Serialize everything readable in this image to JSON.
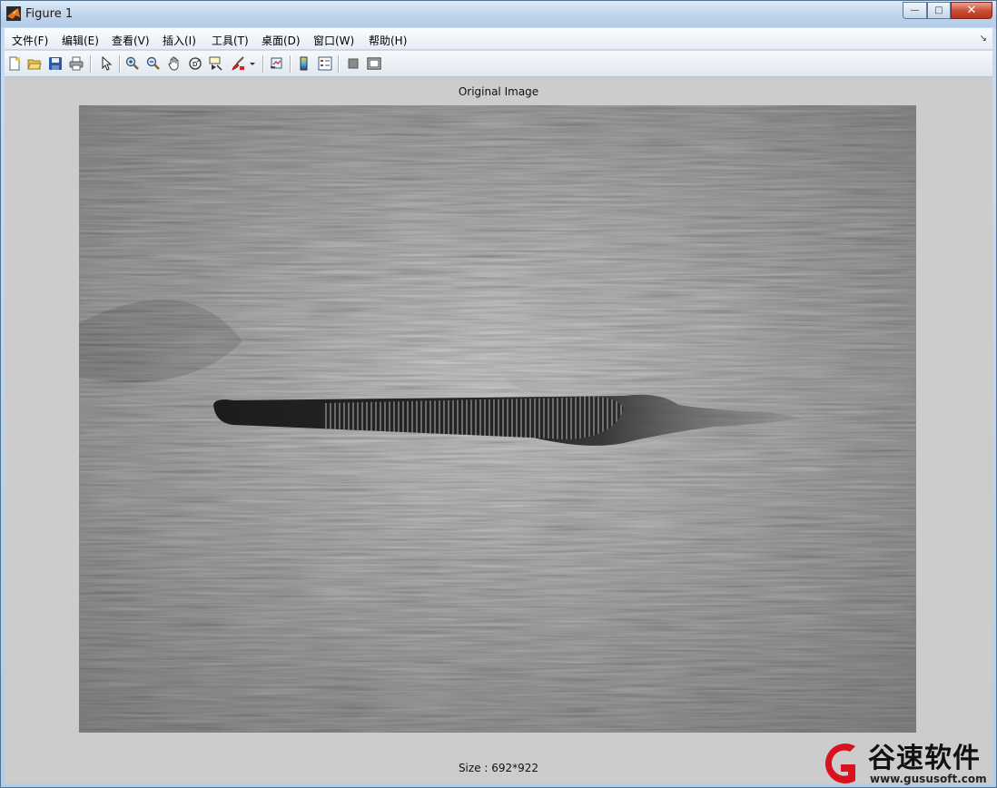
{
  "window": {
    "title": "Figure 1",
    "controls": {
      "minimize": "—",
      "maximize": "□",
      "close": "✕"
    }
  },
  "menubar": {
    "items": [
      {
        "label": "文件(F)"
      },
      {
        "label": "编辑(E)"
      },
      {
        "label": "查看(V)"
      },
      {
        "label": "插入(I)"
      },
      {
        "label": "工具(T)"
      },
      {
        "label": "桌面(D)"
      },
      {
        "label": "窗口(W)"
      },
      {
        "label": "帮助(H)"
      }
    ],
    "dock_arrow": "↘"
  },
  "toolbar": {
    "icons": [
      "new-figure-icon",
      "open-file-icon",
      "save-icon",
      "print-icon",
      "edit-plot-arrow-icon",
      "zoom-in-icon",
      "zoom-out-icon",
      "pan-hand-icon",
      "rotate-3d-icon",
      "data-cursor-icon",
      "brush-icon",
      "link-plot-icon",
      "colorbar-icon",
      "legend-icon",
      "hide-plot-tools-icon",
      "show-plot-tools-icon"
    ]
  },
  "figure": {
    "axes_title": "Original Image",
    "size_label": "Size : 692*922"
  },
  "watermark": {
    "brand": "谷速软件",
    "url": "www.gususoft.com",
    "color": "#d9121f"
  }
}
